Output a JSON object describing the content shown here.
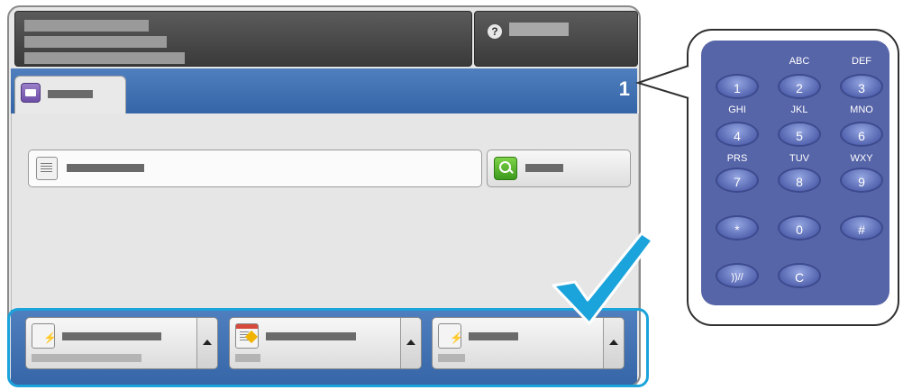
{
  "header": {
    "help_icon": "help-icon"
  },
  "tab": {
    "icon": "printer-icon"
  },
  "job_count": "1",
  "field": {
    "icon": "document-icon"
  },
  "search_button": {
    "icon": "search-icon"
  },
  "features": [
    {
      "icon": "document-bolt-icon"
    },
    {
      "icon": "form-edit-icon"
    },
    {
      "icon": "document-bolt-icon"
    }
  ],
  "keypad": {
    "keys": [
      {
        "label": "1",
        "sub": ""
      },
      {
        "label": "2",
        "sub": "ABC"
      },
      {
        "label": "3",
        "sub": "DEF"
      },
      {
        "label": "4",
        "sub": "GHI"
      },
      {
        "label": "5",
        "sub": "JKL"
      },
      {
        "label": "6",
        "sub": "MNO"
      },
      {
        "label": "7",
        "sub": "PRS"
      },
      {
        "label": "8",
        "sub": "TUV"
      },
      {
        "label": "9",
        "sub": "WXY"
      },
      {
        "label": "*",
        "sub": ""
      },
      {
        "label": "0",
        "sub": ""
      },
      {
        "label": "#",
        "sub": ""
      },
      {
        "label": "))//",
        "sub": ""
      },
      {
        "label": "C",
        "sub": ""
      }
    ]
  },
  "colors": {
    "accent_blue": "#3565a6",
    "highlight": "#1ba3db",
    "keypad": "#5664a8"
  }
}
